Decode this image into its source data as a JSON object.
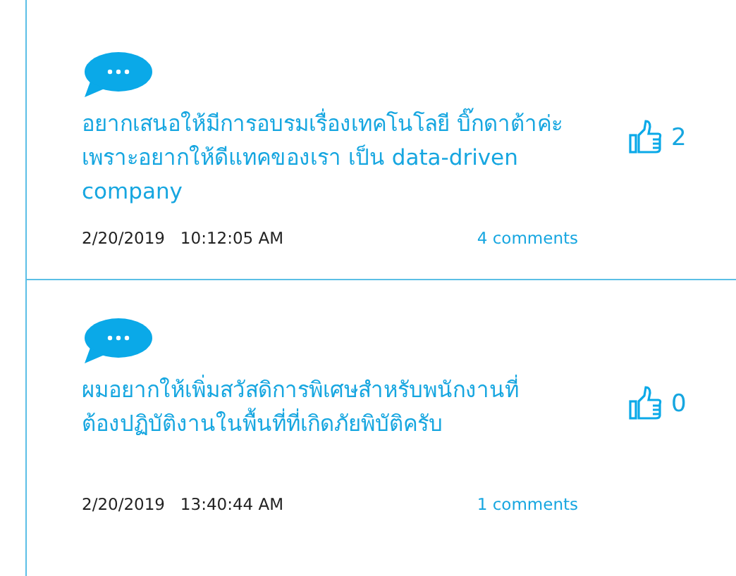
{
  "posts": [
    {
      "text": "อยากเสนอให้มีการอบรมเรื่องเทคโนโลยี บิ๊กดาต้าค่ะ\nเพราะอยากให้ดีแทคของเรา เป็น data-driven company",
      "likes": "2",
      "date": "2/20/2019",
      "time": "10:12:05 AM",
      "comments": "4 comments"
    },
    {
      "text": "ผมอยากให้เพิ่มสวัสดิการพิเศษสำหรับพนักงานที่\nต้องปฏิบัติงานในพื้นที่ที่เกิดภัยพิบัติครับ",
      "likes": "0",
      "date": "2/20/2019",
      "time": "13:40:44 AM",
      "comments": "1 comments"
    }
  ]
}
